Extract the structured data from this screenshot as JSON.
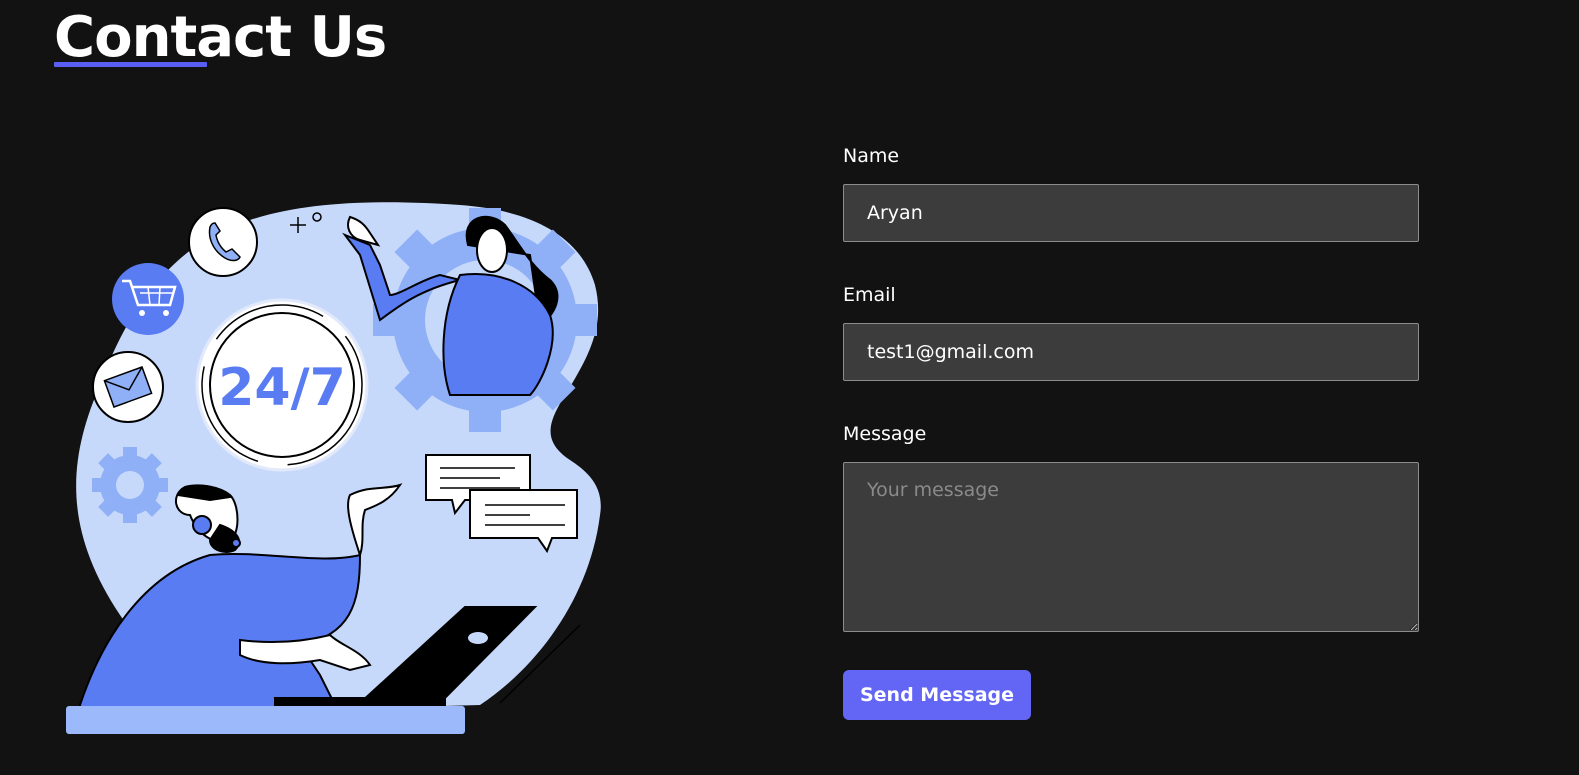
{
  "page": {
    "title": "Contact Us"
  },
  "illustration": {
    "badge_text": "24/7"
  },
  "form": {
    "name_label": "Name",
    "name_value": "Aryan",
    "email_label": "Email",
    "email_value": "test1@gmail.com",
    "message_label": "Message",
    "message_placeholder": "Your message",
    "message_value": "",
    "submit_label": "Send Message"
  },
  "colors": {
    "background": "#121212",
    "accent": "#6366f5",
    "input_background": "#3c3c3c",
    "illustration_blue": "#5a7cf2",
    "illustration_light": "#c7d9fb"
  }
}
